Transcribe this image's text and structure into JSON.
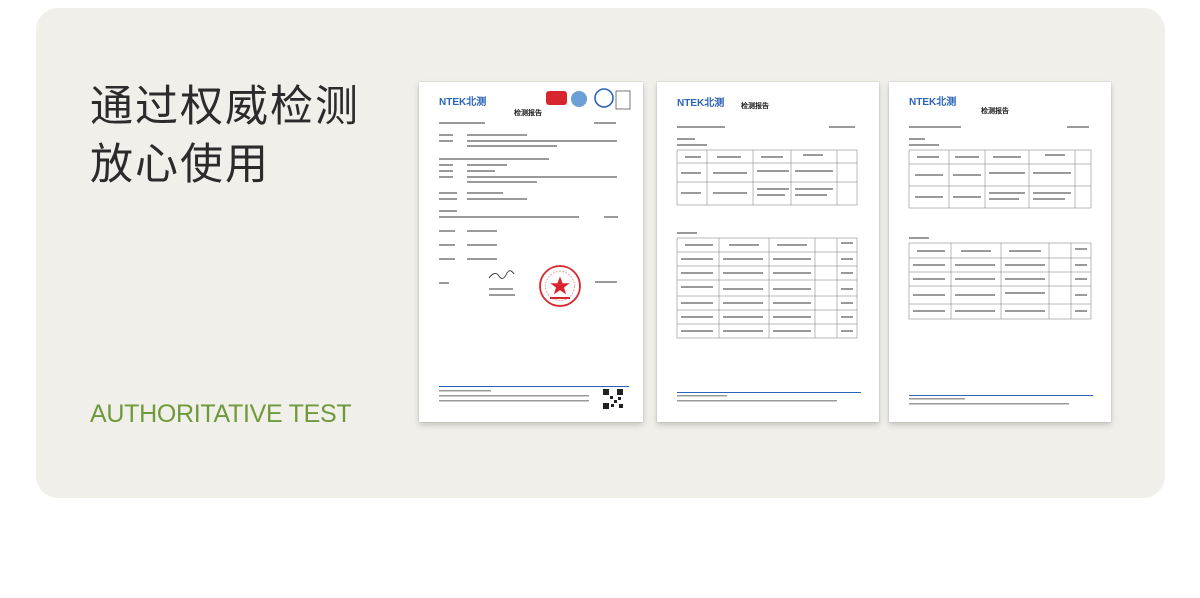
{
  "headline": {
    "line1": "通过权威检测",
    "line2": "放心使用"
  },
  "subline": "AUTHORITATIVE TEST",
  "documents": [
    {
      "logo": "NTEK北测",
      "title": "检测报告"
    },
    {
      "logo": "NTEK北测",
      "title": "检测报告"
    },
    {
      "logo": "NTEK北测",
      "title": "检测报告"
    }
  ],
  "colors": {
    "card_background": "#f1efea",
    "headline": "#2b2b2b",
    "subline": "#6e9a3c",
    "logo": "#2a63b8",
    "seal": "#d8262e"
  },
  "icons": [
    "seal-stamp-icon",
    "qr-code-icon",
    "certification-mark-icon"
  ]
}
